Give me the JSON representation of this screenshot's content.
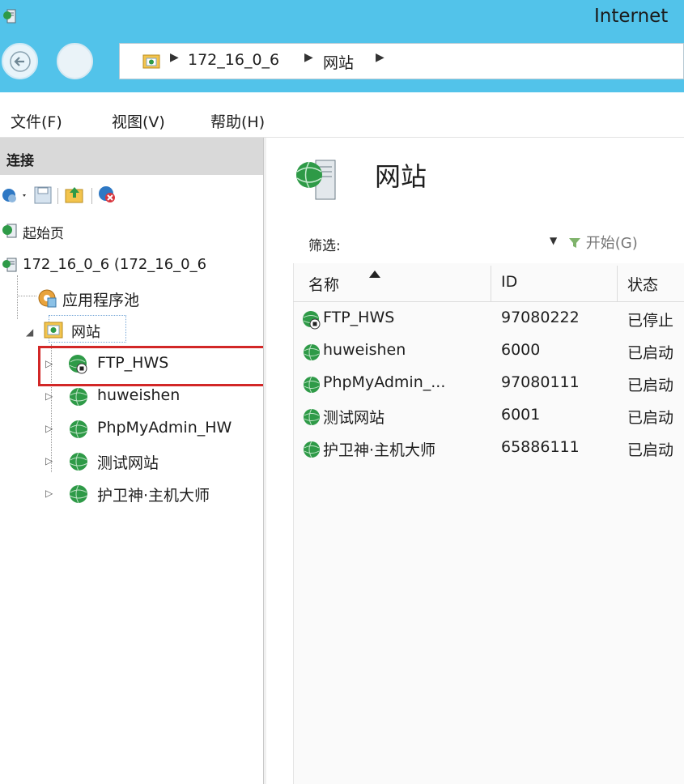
{
  "window": {
    "title": "Internet"
  },
  "breadcrumb": {
    "items": [
      "172_16_0_6",
      "网站"
    ]
  },
  "menu": {
    "items": [
      "文件(F)",
      "视图(V)",
      "帮助(H)"
    ]
  },
  "connections": {
    "header": "连接",
    "tree": {
      "start_page": "起始页",
      "server": "172_16_0_6 (172_16_0_6",
      "app_pools": "应用程序池",
      "sites": "网站",
      "site_items": [
        "FTP_HWS",
        "huweishen",
        "PhpMyAdmin_HW",
        "测试网站",
        "护卫神·主机大师"
      ]
    }
  },
  "main": {
    "title": "网站",
    "filter_label": "筛选:",
    "start_label": "开始(G)",
    "columns": [
      "名称",
      "ID",
      "状态"
    ],
    "rows": [
      {
        "name": "FTP_HWS",
        "id": "97080222",
        "status": "已停止"
      },
      {
        "name": "huweishen",
        "id": "6000",
        "status": "已启动"
      },
      {
        "name": "PhpMyAdmin_...",
        "id": "97080111",
        "status": "已启动"
      },
      {
        "name": "测试网站",
        "id": "6001",
        "status": "已启动"
      },
      {
        "name": "护卫神·主机大师",
        "id": "65886111",
        "status": "已启动"
      }
    ]
  },
  "colors": {
    "titlebar": "#52c3ea",
    "highlight": "#d22727",
    "globe": "#2e9a47"
  }
}
